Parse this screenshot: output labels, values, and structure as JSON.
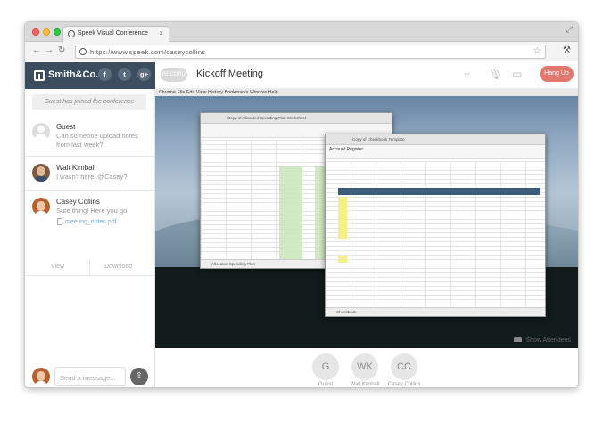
{
  "browser": {
    "tab_title": "Speek Visual Conference",
    "url": "https://www.speek.com/caseycollins"
  },
  "sidebar": {
    "brand": "Smith&Co.",
    "social": [
      "f",
      "t",
      "g+"
    ],
    "system_message": "Guest has joined the conference",
    "messages": [
      {
        "name": "Guest",
        "text": "Can someone upload notes from last week?"
      },
      {
        "name": "Walt Kimball",
        "text": "I wasn't here. @Casey?"
      },
      {
        "name": "Casey Collins",
        "text": "Sure thing! Here you go.",
        "attachment": "meeting_notes.pdf"
      }
    ],
    "attachment_actions": {
      "view": "View",
      "download": "Download"
    },
    "composer_placeholder": "Send a message..."
  },
  "main": {
    "status_pill": "RECORD",
    "title": "Kickoff Meeting",
    "hangup": "Hang Up",
    "show_attendees": "Show Attendees",
    "shared_screen": {
      "mac_menu": "Chrome   File   Edit   View   History   Bookmarks   Window   Help",
      "sheet1_title": "Copy of Allocated Spending Plan Worksheet",
      "sheet1_tab": "Allocated Spending Plan",
      "sheet2_title": "Copy of Checkbook Template",
      "sheet2_tab": "Checkbook",
      "sheet2_subtitle": "Account Register"
    },
    "attendees": [
      {
        "initials": "G",
        "name": "Guest"
      },
      {
        "initials": "WK",
        "name": "Walt Kimball"
      },
      {
        "initials": "CC",
        "name": "Casey Collins"
      }
    ]
  },
  "colors": {
    "brand_bar": "#3b4d5f",
    "hangup": "#e2776d",
    "link": "#7aa7d0"
  }
}
